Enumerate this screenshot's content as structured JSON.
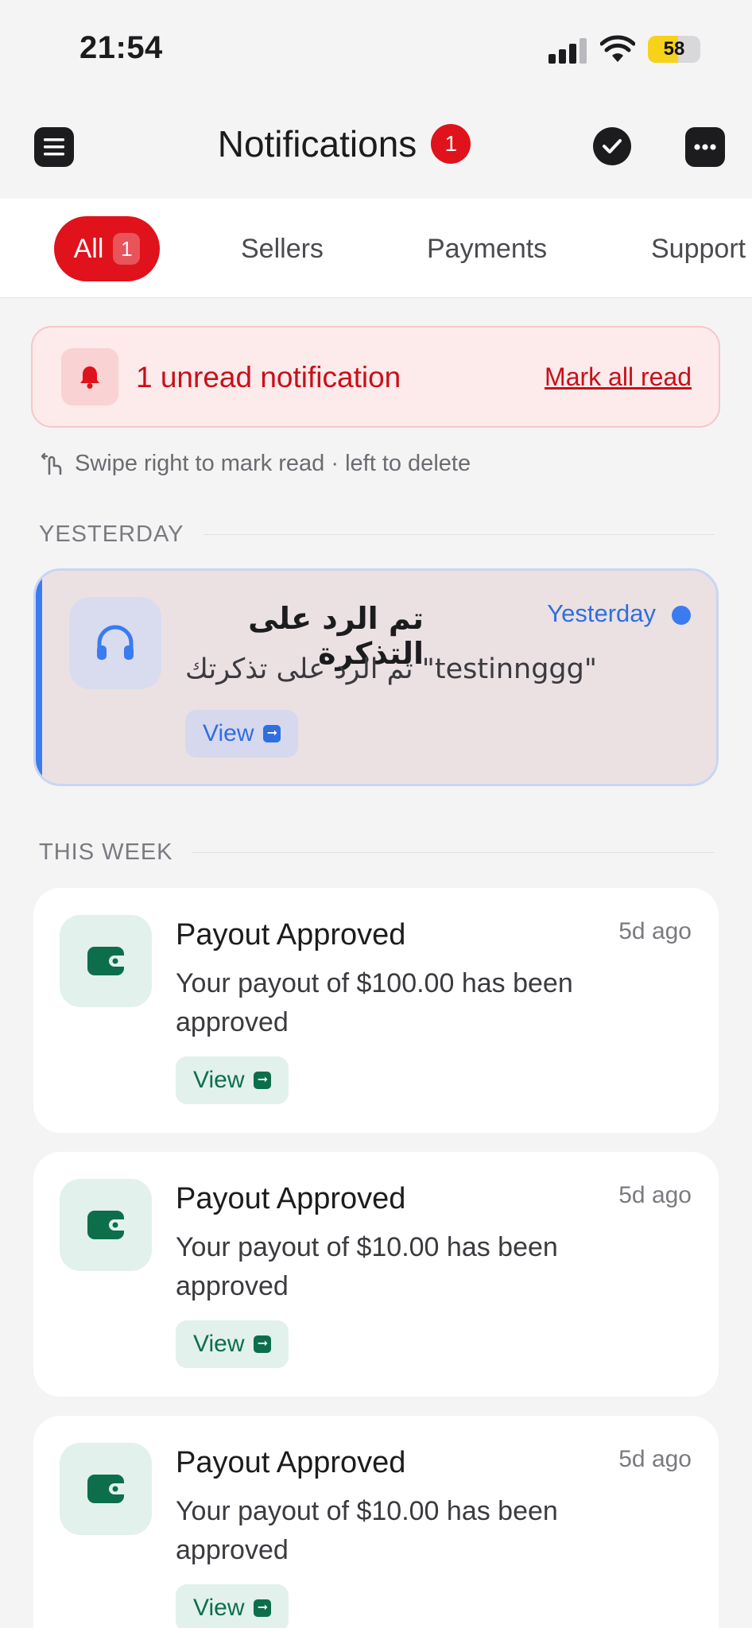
{
  "status_bar": {
    "time": "21:54",
    "battery": "58",
    "battery_level": 0.58
  },
  "header": {
    "title": "Notifications",
    "badge": "1"
  },
  "tabs": [
    {
      "label": "All",
      "count": "1"
    },
    {
      "label": "Sellers"
    },
    {
      "label": "Payments"
    },
    {
      "label": "Support"
    }
  ],
  "banner": {
    "text": "1 unread notification",
    "action": "Mark all read"
  },
  "hint": "Swipe right to mark read · left to delete",
  "sections": {
    "yesterday": "YESTERDAY",
    "this_week": "THIS WEEK"
  },
  "notifications": [
    {
      "title": "تم الرد على التذكرة",
      "body": "تم الرد على تذكرتك \"testinnggg\"",
      "time": "Yesterday",
      "action": "View",
      "icon": "headphones-icon",
      "unread": true
    },
    {
      "title": "Payout Approved",
      "body": "Your payout of $100.00 has been approved",
      "time": "5d ago",
      "action": "View",
      "icon": "wallet-icon"
    },
    {
      "title": "Payout Approved",
      "body": "Your payout of $10.00 has been approved",
      "time": "5d ago",
      "action": "View",
      "icon": "wallet-icon"
    },
    {
      "title": "Payout Approved",
      "body": "Your payout of $10.00 has been approved",
      "time": "5d ago",
      "action": "View",
      "icon": "wallet-icon"
    }
  ],
  "colors": {
    "accent_red": "#e0121b",
    "unread_blue": "#3a7bf0",
    "payout_green": "#0d6e4c"
  }
}
